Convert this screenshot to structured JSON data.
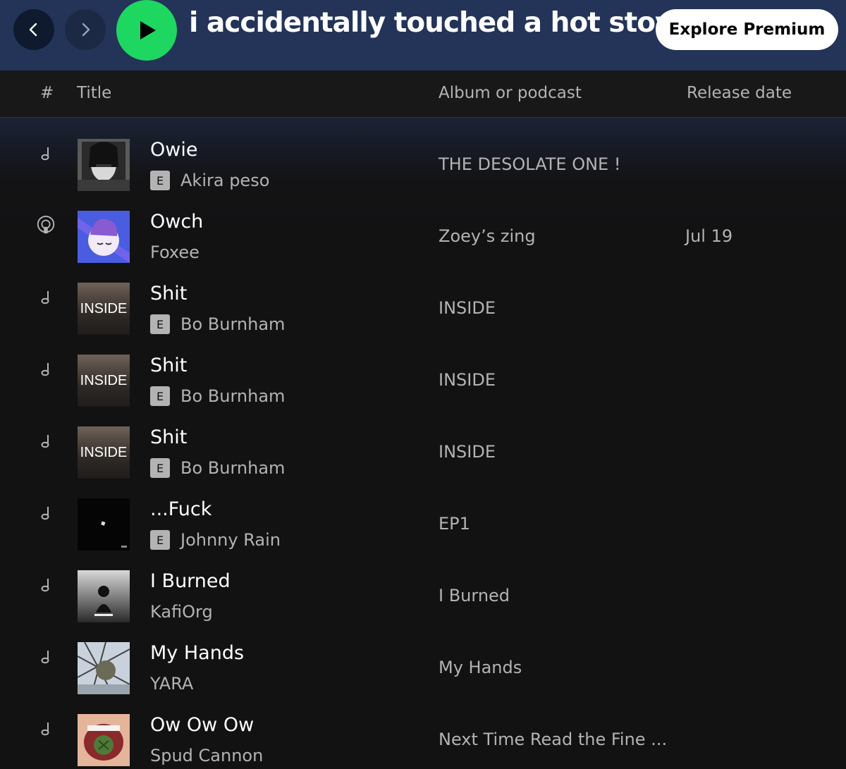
{
  "header": {
    "title": "i accidentally touched a hot stove",
    "premium_label": "Explore Premium"
  },
  "columns": {
    "number": "#",
    "title": "Title",
    "album": "Album or podcast",
    "release_date": "Release date"
  },
  "tracks": [
    {
      "type_icon": "note-icon",
      "title": "Owie",
      "explicit": true,
      "artist": "Akira peso",
      "album": "THE DESOLATE ONE !",
      "date": ""
    },
    {
      "type_icon": "podcast-icon",
      "title": "Owch",
      "explicit": false,
      "artist": "Foxee",
      "album": "Zoey’s zing",
      "date": "Jul 19"
    },
    {
      "type_icon": "note-icon",
      "title": "Shit",
      "explicit": true,
      "artist": "Bo Burnham",
      "album": "INSIDE",
      "date": "",
      "cover_text": "INSIDE"
    },
    {
      "type_icon": "note-icon",
      "title": "Shit",
      "explicit": true,
      "artist": "Bo Burnham",
      "album": "INSIDE",
      "date": "",
      "cover_text": "INSIDE"
    },
    {
      "type_icon": "note-icon",
      "title": "Shit",
      "explicit": true,
      "artist": "Bo Burnham",
      "album": "INSIDE",
      "date": "",
      "cover_text": "INSIDE"
    },
    {
      "type_icon": "note-icon",
      "title": "...Fuck",
      "explicit": true,
      "artist": "Johnny Rain",
      "album": "EP1",
      "date": ""
    },
    {
      "type_icon": "note-icon",
      "title": "I Burned",
      "explicit": false,
      "artist": "KafiOrg",
      "album": "I Burned",
      "date": ""
    },
    {
      "type_icon": "note-icon",
      "title": "My Hands",
      "explicit": false,
      "artist": "YARA",
      "album": "My Hands",
      "date": ""
    },
    {
      "type_icon": "note-icon",
      "title": "Ow Ow Ow",
      "explicit": false,
      "artist": "Spud Cannon",
      "album": "Next Time Read the Fine ...",
      "date": ""
    }
  ],
  "explicit_label": "E",
  "colors": {
    "topbar": "#233458",
    "play": "#1ed760",
    "background": "#121212"
  }
}
